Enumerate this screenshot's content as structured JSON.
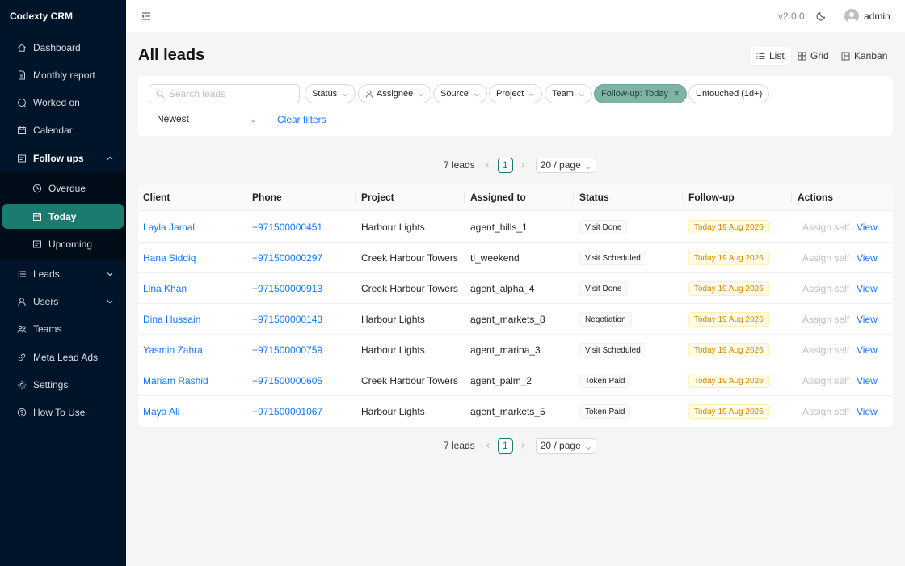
{
  "app": {
    "brand": "Codexty CRM",
    "version": "v2.0.0",
    "user": "admin"
  },
  "sidebar": {
    "items": [
      {
        "key": "dashboard",
        "label": "Dashboard",
        "icon": "home-icon"
      },
      {
        "key": "monthly-report",
        "label": "Monthly report",
        "icon": "file-icon"
      },
      {
        "key": "worked-on",
        "label": "Worked on",
        "icon": "chat-icon"
      },
      {
        "key": "calendar",
        "label": "Calendar",
        "icon": "calendar-icon"
      },
      {
        "key": "follow-ups",
        "label": "Follow ups",
        "icon": "schedule-icon",
        "expanded": true
      },
      {
        "key": "overdue",
        "label": "Overdue",
        "icon": "clock-icon",
        "sub": true
      },
      {
        "key": "today",
        "label": "Today",
        "icon": "calendar-icon",
        "sub": true,
        "active": true
      },
      {
        "key": "upcoming",
        "label": "Upcoming",
        "icon": "schedule-icon",
        "sub": true
      },
      {
        "key": "leads",
        "label": "Leads",
        "icon": "list-icon",
        "expandable": true
      },
      {
        "key": "users",
        "label": "Users",
        "icon": "user-icon",
        "expandable": true
      },
      {
        "key": "teams",
        "label": "Teams",
        "icon": "team-icon"
      },
      {
        "key": "meta-lead-ads",
        "label": "Meta Lead Ads",
        "icon": "link-icon"
      },
      {
        "key": "settings",
        "label": "Settings",
        "icon": "gear-icon"
      },
      {
        "key": "how-to-use",
        "label": "How To Use",
        "icon": "question-icon"
      }
    ]
  },
  "header": {
    "title": "All leads",
    "views": [
      {
        "key": "list",
        "label": "List",
        "active": true
      },
      {
        "key": "grid",
        "label": "Grid"
      },
      {
        "key": "kanban",
        "label": "Kanban"
      }
    ]
  },
  "filters": {
    "search_placeholder": "Search leads",
    "chips": [
      {
        "key": "status",
        "label": "Status"
      },
      {
        "key": "assignee",
        "label": "Assignee"
      },
      {
        "key": "source",
        "label": "Source"
      },
      {
        "key": "project",
        "label": "Project"
      },
      {
        "key": "team",
        "label": "Team"
      },
      {
        "key": "follow-up",
        "label": "Follow-up: Today",
        "active": true
      },
      {
        "key": "untouched",
        "label": "Untouched (1d+)"
      }
    ],
    "sort": "Newest",
    "clear": "Clear filters"
  },
  "pagination": {
    "total": "7 leads",
    "page": "1",
    "page_size": "20 / page"
  },
  "table": {
    "columns": [
      "Client",
      "Phone",
      "Project",
      "Assigned to",
      "Status",
      "Follow-up",
      "Actions"
    ],
    "rows": [
      {
        "client": "Layla Jamal",
        "phone": "+971500000451",
        "project": "Harbour Lights",
        "assigned": "agent_hills_1",
        "status": "Visit Done",
        "followup": "Today 19 Aug 2026"
      },
      {
        "client": "Hana Siddiq",
        "phone": "+971500000297",
        "project": "Creek Harbour Towers",
        "assigned": "tl_weekend",
        "status": "Visit Scheduled",
        "followup": "Today 19 Aug 2026"
      },
      {
        "client": "Lina Khan",
        "phone": "+971500000913",
        "project": "Creek Harbour Towers",
        "assigned": "agent_alpha_4",
        "status": "Visit Done",
        "followup": "Today 19 Aug 2026"
      },
      {
        "client": "Dina Hussain",
        "phone": "+971500000143",
        "project": "Harbour Lights",
        "assigned": "agent_markets_8",
        "status": "Negotiation",
        "followup": "Today 19 Aug 2026"
      },
      {
        "client": "Yasmin Zahra",
        "phone": "+971500000759",
        "project": "Harbour Lights",
        "assigned": "agent_marina_3",
        "status": "Visit Scheduled",
        "followup": "Today 19 Aug 2026"
      },
      {
        "client": "Mariam Rashid",
        "phone": "+971500000605",
        "project": "Creek Harbour Towers",
        "assigned": "agent_palm_2",
        "status": "Token Paid",
        "followup": "Today 19 Aug 2026"
      },
      {
        "client": "Maya Ali",
        "phone": "+971500001067",
        "project": "Harbour Lights",
        "assigned": "agent_markets_5",
        "status": "Token Paid",
        "followup": "Today 19 Aug 2026"
      }
    ],
    "actions": {
      "assign_self": "Assign self",
      "view": "View"
    }
  },
  "colors": {
    "sidebar_bg": "#001529",
    "accent": "#1b7b6e",
    "link": "#1677ff",
    "followup": "#d48806"
  }
}
